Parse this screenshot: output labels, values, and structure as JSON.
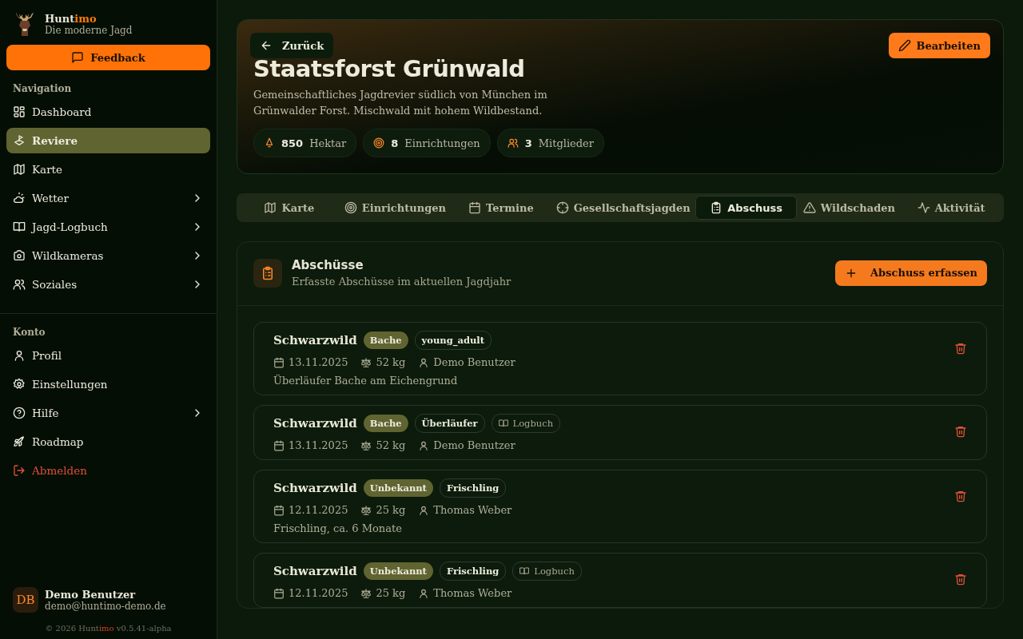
{
  "brand": {
    "name": "Hunt",
    "name_accent": "imo",
    "tagline": "Die moderne Jagd"
  },
  "feedback_button": "Feedback",
  "nav_sections": [
    {
      "title": "Navigation",
      "items": [
        {
          "label": "Dashboard",
          "selected": false,
          "expandable": false,
          "kind": "link"
        },
        {
          "label": "Reviere",
          "selected": true,
          "expandable": false,
          "kind": "link"
        },
        {
          "label": "Karte",
          "selected": false,
          "expandable": false,
          "kind": "link"
        },
        {
          "label": "Wetter",
          "selected": false,
          "expandable": true,
          "kind": "link"
        },
        {
          "label": "Jagd-Logbuch",
          "selected": false,
          "expandable": true,
          "kind": "link"
        },
        {
          "label": "Wildkameras",
          "selected": false,
          "expandable": true,
          "kind": "link"
        },
        {
          "label": "Soziales",
          "selected": false,
          "expandable": true,
          "kind": "link"
        }
      ]
    },
    {
      "title": "Konto",
      "items": [
        {
          "label": "Profil",
          "selected": false,
          "expandable": false,
          "kind": "link"
        },
        {
          "label": "Einstellungen",
          "selected": false,
          "expandable": false,
          "kind": "link"
        },
        {
          "label": "Hilfe",
          "selected": false,
          "expandable": true,
          "kind": "link"
        },
        {
          "label": "Roadmap",
          "selected": false,
          "expandable": false,
          "kind": "link"
        },
        {
          "label": "Abmelden",
          "selected": false,
          "expandable": false,
          "kind": "danger"
        }
      ]
    }
  ],
  "user": {
    "initials": "DB",
    "name": "Demo Benutzer",
    "email": "demo@huntimo-demo.de"
  },
  "footer": {
    "prefix": "© 2026 Hunt",
    "accent": "imo",
    "suffix": " v0.5.41-alpha"
  },
  "header": {
    "back_button": "Zurück",
    "edit_button": "Bearbeiten",
    "title": "Staatsforst Grünwald",
    "description": "Gemeinschaftliches Jagdrevier südlich von München im Grünwalder Forst. Mischwald mit hohem Wildbestand.",
    "stats": [
      {
        "value": "850",
        "label": "Hektar"
      },
      {
        "value": "8",
        "label": "Einrichtungen"
      },
      {
        "value": "3",
        "label": "Mitglieder"
      }
    ]
  },
  "tabs": [
    {
      "label": "Karte",
      "selected": false
    },
    {
      "label": "Einrichtungen",
      "selected": false
    },
    {
      "label": "Termine",
      "selected": false
    },
    {
      "label": "Gesellschaftsjagden",
      "selected": false
    },
    {
      "label": "Abschuss",
      "selected": true
    },
    {
      "label": "Wildschaden",
      "selected": false
    },
    {
      "label": "Aktivität",
      "selected": false
    }
  ],
  "harvests": {
    "title": "Abschüsse",
    "subtitle": "Erfasste Abschüsse im aktuellen Jagdjahr",
    "add_button": "Abschuss erfassen",
    "records": [
      {
        "species": "Schwarzwild",
        "tags": [
          {
            "label": "Bache",
            "kind": "sex"
          },
          {
            "label": "young_adult",
            "kind": "age"
          }
        ],
        "date": "13.11.2025",
        "weight": "52 kg",
        "hunter": "Demo Benutzer",
        "note": "Überläufer Bache am Eichengrund"
      },
      {
        "species": "Schwarzwild",
        "tags": [
          {
            "label": "Bache",
            "kind": "sex"
          },
          {
            "label": "Überläufer",
            "kind": "age"
          },
          {
            "label": "Logbuch",
            "kind": "logbook"
          }
        ],
        "date": "13.11.2025",
        "weight": "52 kg",
        "hunter": "Demo Benutzer"
      },
      {
        "species": "Schwarzwild",
        "tags": [
          {
            "label": "Unbekannt",
            "kind": "sex"
          },
          {
            "label": "Frischling",
            "kind": "age"
          }
        ],
        "date": "12.11.2025",
        "weight": "25 kg",
        "hunter": "Thomas Weber",
        "note": "Frischling, ca. 6 Monate"
      },
      {
        "species": "Schwarzwild",
        "tags": [
          {
            "label": "Unbekannt",
            "kind": "sex"
          },
          {
            "label": "Frischling",
            "kind": "age"
          },
          {
            "label": "Logbuch",
            "kind": "logbook"
          }
        ],
        "date": "12.11.2025",
        "weight": "25 kg",
        "hunter": "Thomas Weber"
      }
    ]
  }
}
